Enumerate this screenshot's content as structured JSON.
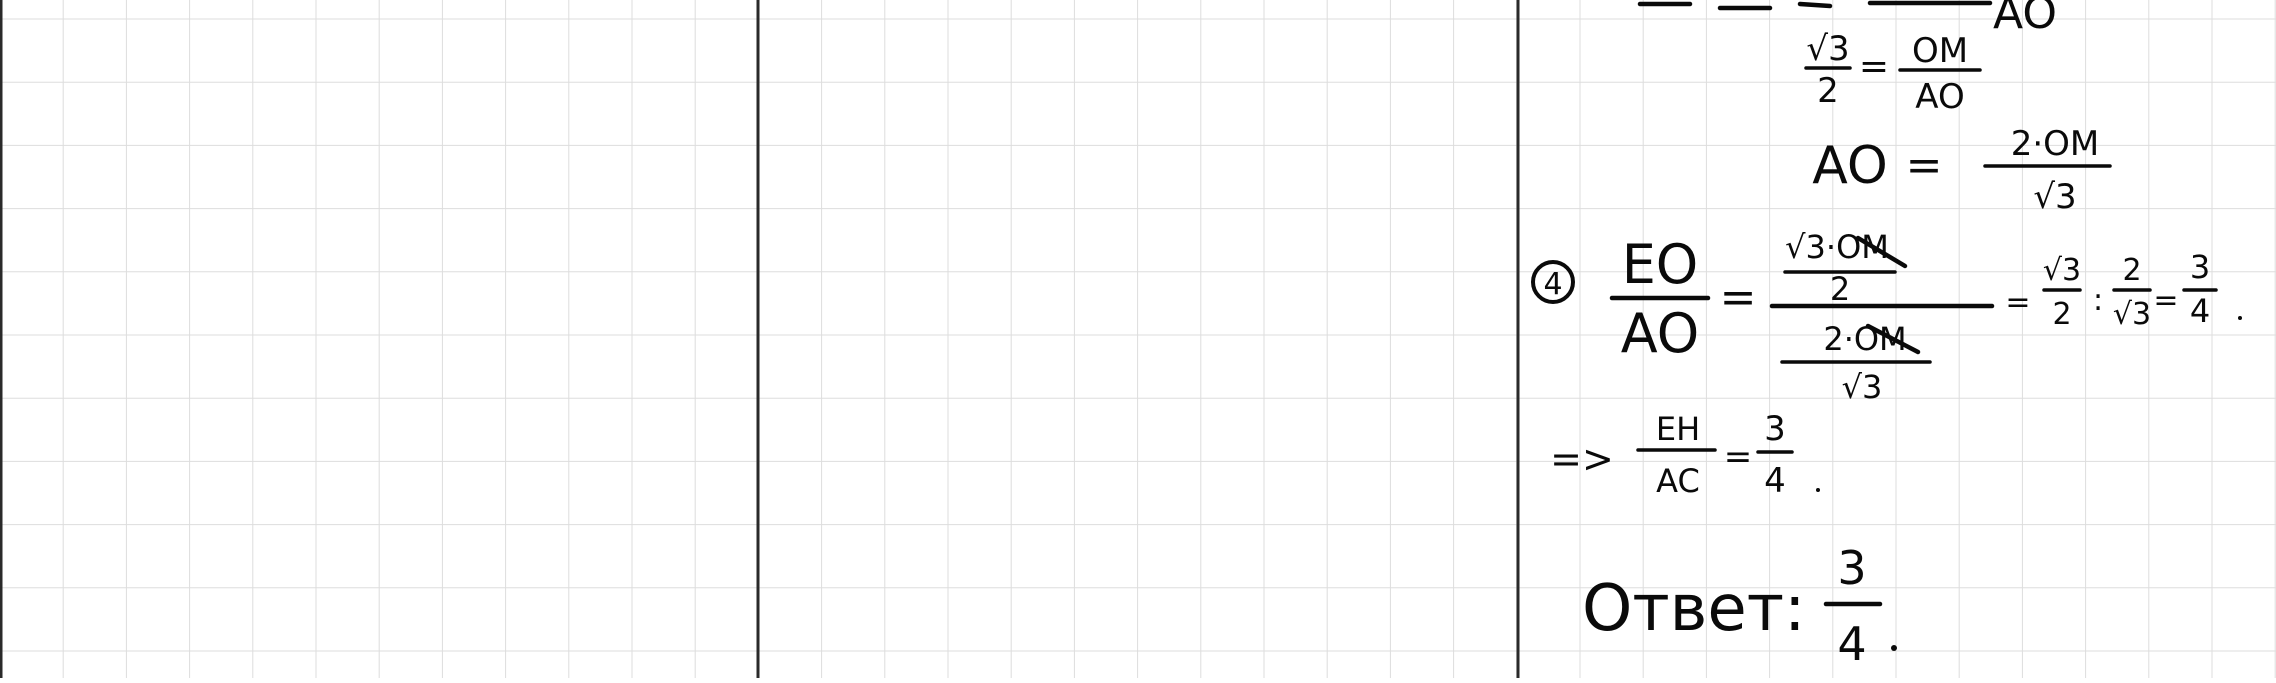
{
  "colors": {
    "background": "#ffffff",
    "grid_line": "#dddddd",
    "page_border": "#2a2a2a",
    "ink": "#0a0a0a"
  },
  "notes": {
    "top_partial": "AO",
    "line1": {
      "num": "√3",
      "den": "2",
      "eq": "=",
      "rnum": "OM",
      "rden": "AO"
    },
    "line2": {
      "lhs": "AO",
      "eq": "=",
      "num": "2·OM",
      "den": "√3"
    },
    "line3": {
      "step": "4",
      "lnum": "EO",
      "lden": "AO",
      "eq": "=",
      "top_num": "√3·OM",
      "top_den": "2",
      "bot_num": "2·OM",
      "bot_den": "√3",
      "eq2": "=",
      "a_num": "√3",
      "a_den": "2",
      "div": ":",
      "b_num": "2",
      "b_den": "√3",
      "eq3": "=",
      "r_num": "3",
      "r_den": "4"
    },
    "line4": {
      "implies": "=>",
      "num": "EH",
      "den": "AC",
      "eq": "=",
      "rnum": "3",
      "rden": "4"
    },
    "answer": {
      "label": "Ответ:",
      "num": "3",
      "den": "4"
    }
  }
}
